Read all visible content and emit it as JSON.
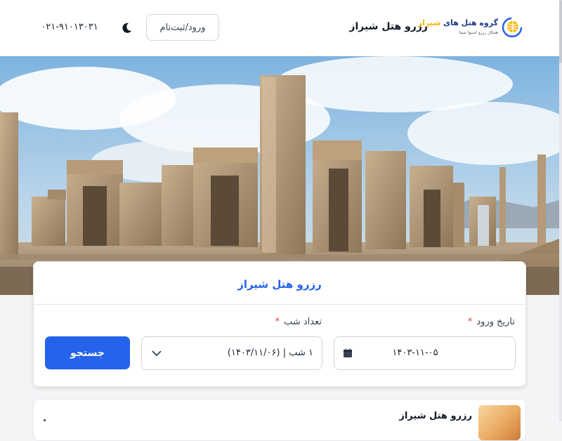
{
  "header": {
    "logo_prefix": "گروه هتل های",
    "logo_accent": "شیراز",
    "logo_subtitle": "همکار رزرو اسنوا سپتا",
    "site_name": "رزرو هتل شیراز",
    "login_label": "ورود/ثبت‌نام",
    "phone": "۰۲۱-۹۱۰۱۳۰۳۱",
    "theme_icon": "moon-icon",
    "logo_icon": "globe-icon"
  },
  "search": {
    "title": "رزرو هتل شیراز",
    "checkin_label": "تاریخ ورود",
    "checkin_value": "۱۴۰۳-۱۱-۰۵",
    "nights_label": "تعداد شب",
    "nights_value": "۱ شب | (۱۴۰۳/۱۱/۰۶)",
    "required_mark": "*",
    "button_label": "جستجو",
    "calendar_icon": "calendar-icon",
    "dropdown_icon": "chevron-down-icon"
  },
  "result": {
    "title": "رزرو هتل شیراز"
  },
  "colors": {
    "accent": "#2563eb",
    "logo_accent": "#f5b50a",
    "required": "#ef4444"
  }
}
